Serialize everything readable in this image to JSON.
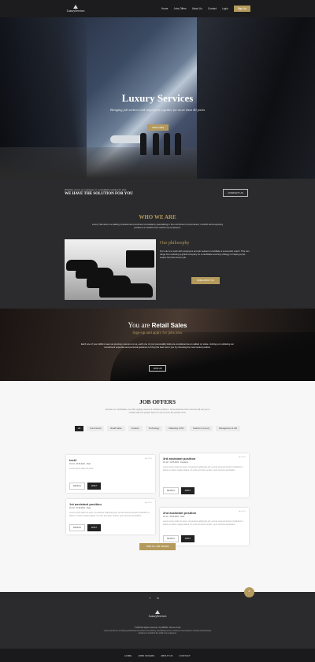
{
  "nav": {
    "logo_text": "LuxuryServices",
    "items": [
      "Home",
      "Jobs Offers",
      "About Us",
      "Contact",
      "Login"
    ],
    "signup": "Sign Up"
  },
  "hero": {
    "title": "Luxury Services",
    "subtitle": "Bringing job seekers and employers together for more than 40 years",
    "button": "VIEW JOBS"
  },
  "contact_band": {
    "line1": "Whether you're an employer or a candidate looking for jobs",
    "line2": "WE HAVE THE SOLUTION FOR YOU",
    "button": "CONTACT US"
  },
  "who": {
    "title": "WHO WE ARE",
    "intro": "Luxury Services is a leading professional recruitment consultancy specialising in the recruitment of permanent, contract and temporary positions on behalf of the world's top employers.",
    "philosophy_title": "Our philosophy",
    "philosophy_text": "Our role is to work with employers and job seekers to facilitate a successful match. This can range from advising a global company on a candidate sourcing strategy to helping a job-seeker find their dream job.",
    "button": "MORE ABOUT US"
  },
  "retail": {
    "you_are": "You are",
    "role": "Retail Sales",
    "subtitle": "Sign-up and apply for jobs now",
    "text": "Each one of your skills is seen as precious resource to us, each one of your personality traits are considered as an added on value. Joining us is allowing our recruitment expertise and personal guidance to bring the best out in you by choosing the most suited position.",
    "button": "JOIN US"
  },
  "jobs": {
    "title": "JOB OFFERS",
    "intro": "Just like our candidates, we offer quality, serious & reliable positions. Come discover them and we will put you in contact with the perfect team for you to form the perfect crew.",
    "tabs": [
      "All",
      "Commercial",
      "Retail Sales",
      "Creative",
      "Technology",
      "Marketing & PR",
      "Fashion & Luxury",
      "Management & HR"
    ],
    "details_label": "DETAILS",
    "apply_label": "APPLY",
    "cards": [
      {
        "title": "test2",
        "date": "Apr 2021",
        "meta1": "CC 0d",
        "meta2": "06.05.2021",
        "meta3": "Paris",
        "body": "Lorem ipsum dolor sit amet..."
      },
      {
        "title": "1st assistant position",
        "date": "Apr 2021",
        "meta1": "CC 0d",
        "meta2": "07.09.2021",
        "meta3": "Paris",
        "body": "Lorem ipsum dolor sit amet, consectetur adipiscing elit, sed do eiusmod tempor incididunt ut labore et dolore magna aliqua. Ut enim ad minim veniam, quis nostrud exercitation..."
      },
      {
        "title": "3rd assistant position",
        "date": "Apr 2021",
        "meta1": "CC 0d",
        "meta2": "21.05.2021",
        "meta3": "Freelance",
        "body": "Lorem ipsum dolor sit amet, consectetur adipiscing elit, sed do eiusmod tempor incididunt ut labore et dolore magna aliqua. Ut enim ad minim veniam, quis nostrud exercitation..."
      },
      {
        "title": "2nd assistant position",
        "date": "Apr 2021",
        "meta1": "CC 0d",
        "meta2": "30.06.2021",
        "meta3": "Paris",
        "body": "Lorem ipsum dolor sit amet, consectetur adipiscing elit, sed do eiusmod tempor incididunt ut labore et dolore magna aliqua. Ut enim ad minim veniam, quis nostrud exercitation..."
      }
    ],
    "view_all": "VIEW ALL JOB OFFERS"
  },
  "footer": {
    "up_icon": "chevron-up-icon",
    "social": [
      "f",
      "in"
    ],
    "logo_text": "LuxuryServices",
    "copyright": "© 2019 All rights reserved • by IDHNR • Terms of use",
    "description": "Luxury Services is a leading professional recruitment consultancy specialising in the recruitment of permanent, contract and temporary positions on behalf of the world's top employers.",
    "bottom_nav": [
      "HOME",
      "JOBS OFFERS",
      "ABOUT US",
      "CONTACT"
    ]
  }
}
